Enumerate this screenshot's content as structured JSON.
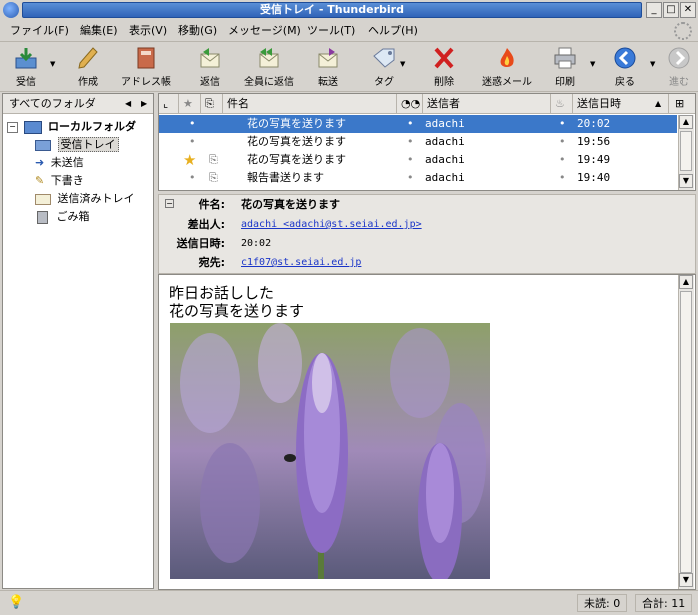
{
  "window": {
    "title": "受信トレイ - Thunderbird"
  },
  "menu": [
    "ファイル(F)",
    "編集(E)",
    "表示(V)",
    "移動(G)",
    "メッセージ(M)",
    "ツール(T)",
    "ヘルプ(H)"
  ],
  "toolbar": {
    "get": "受信",
    "write": "作成",
    "address": "アドレス帳",
    "reply": "返信",
    "replyall": "全員に返信",
    "forward": "転送",
    "tag": "タグ",
    "delete": "削除",
    "junk": "迷惑メール",
    "print": "印刷",
    "back": "戻る",
    "forward_nav": "進む"
  },
  "folders": {
    "header": "すべてのフォルダ",
    "root": "ローカルフォルダ",
    "items": [
      "受信トレイ",
      "未送信",
      "下書き",
      "送信済みトレイ",
      "ごみ箱"
    ]
  },
  "thread": {
    "columns": {
      "subject": "件名",
      "sender": "送信者",
      "date": "送信日時"
    },
    "rows": [
      {
        "subject": "花の写真を送ります",
        "sender": "adachi",
        "date": "20:02"
      },
      {
        "subject": "花の写真を送ります",
        "sender": "adachi",
        "date": "19:56"
      },
      {
        "subject": "花の写真を送ります",
        "sender": "adachi",
        "date": "19:49"
      },
      {
        "subject": "報告書送ります",
        "sender": "adachi",
        "date": "19:40"
      }
    ]
  },
  "header": {
    "subject_label": "件名:",
    "subject": "花の写真を送ります",
    "from_label": "差出人:",
    "from": "adachi <adachi@st.seiai.ed.jp>",
    "date_label": "送信日時:",
    "date": "20:02",
    "to_label": "宛先:",
    "to": "c1f07@st.seiai.ed.jp"
  },
  "body": {
    "line1": "昨日お話しした",
    "line2": "花の写真を送ります"
  },
  "status": {
    "unread": "未読: 0",
    "total": "合計: 11"
  }
}
